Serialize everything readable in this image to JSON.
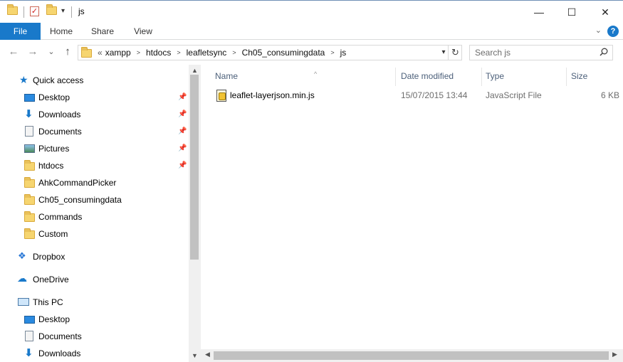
{
  "window": {
    "title": "js",
    "minimize_glyph": "—",
    "maximize_glyph": "☐",
    "close_glyph": "✕"
  },
  "ribbon": {
    "tabs": [
      "File",
      "Home",
      "Share",
      "View"
    ],
    "help_glyph": "?"
  },
  "nav": {
    "back_glyph": "←",
    "forward_glyph": "→",
    "recent_glyph": "⌄",
    "up_glyph": "↑"
  },
  "address": {
    "overflow": "«",
    "crumbs": [
      "xampp",
      "htdocs",
      "leafletsync",
      "Ch05_consumingdata",
      "js"
    ]
  },
  "search": {
    "placeholder": "Search js"
  },
  "sidebar": {
    "quick_access": {
      "label": "Quick access",
      "items": [
        {
          "label": "Desktop",
          "icon": "desktop-icon",
          "pinned": true
        },
        {
          "label": "Downloads",
          "icon": "downloads-icon",
          "pinned": true
        },
        {
          "label": "Documents",
          "icon": "documents-icon",
          "pinned": true
        },
        {
          "label": "Pictures",
          "icon": "pictures-icon",
          "pinned": true
        },
        {
          "label": "htdocs",
          "icon": "folder-icon",
          "pinned": true
        },
        {
          "label": "AhkCommandPicker",
          "icon": "folder-icon",
          "pinned": false
        },
        {
          "label": "Ch05_consumingdata",
          "icon": "folder-icon",
          "pinned": false
        },
        {
          "label": "Commands",
          "icon": "folder-icon",
          "pinned": false
        },
        {
          "label": "Custom",
          "icon": "folder-icon",
          "pinned": false
        }
      ]
    },
    "dropbox": "Dropbox",
    "onedrive": "OneDrive",
    "this_pc": {
      "label": "This PC",
      "items": [
        {
          "label": "Desktop",
          "icon": "desktop-icon"
        },
        {
          "label": "Documents",
          "icon": "documents-icon"
        },
        {
          "label": "Downloads",
          "icon": "downloads-icon"
        }
      ]
    }
  },
  "filelist": {
    "columns": [
      "Name",
      "Date modified",
      "Type",
      "Size"
    ],
    "rows": [
      {
        "name": "leaflet-layerjson.min.js",
        "date": "15/07/2015 13:44",
        "type": "JavaScript File",
        "size": "6 KB"
      }
    ]
  },
  "colors": {
    "accent": "#1979ca",
    "column_header": "#4c607a"
  }
}
